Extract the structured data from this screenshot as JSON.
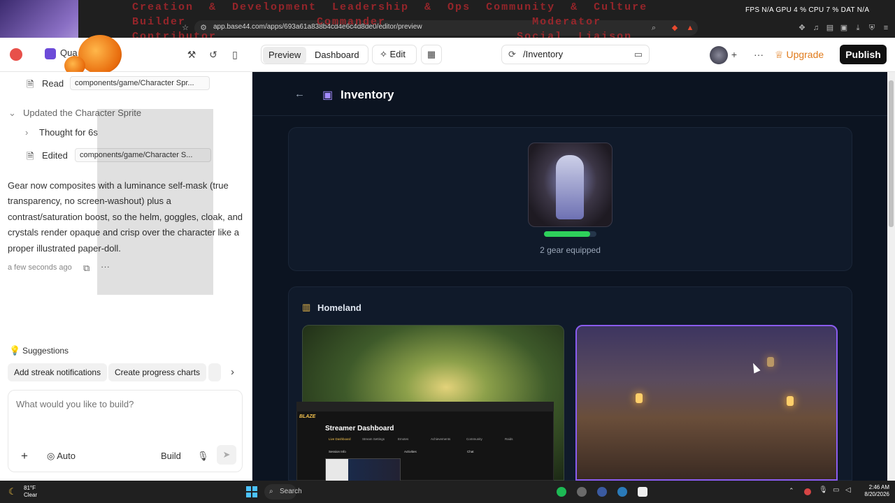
{
  "browser": {
    "url": "app.base44.com/apps/693a61a838b4cd4e6c4d8de0/editor/preview",
    "overlay_text": "Creation  &  Development  Leadership  &  Ops  Community  &  Culture\nBuilder                 Commander                   Moderator\nContributor                                       Social  Liaison\nCollaborator",
    "stats": "FPS N/A   GPU 4 %   CPU 7 %   DAT N/A"
  },
  "topbar": {
    "project_label": "Qua",
    "tab_preview": "Preview",
    "tab_dashboard": "Dashboard",
    "edit_label": "Edit",
    "route": "/Inventory",
    "upgrade_label": "Upgrade",
    "publish_label": "Publish"
  },
  "chat": {
    "read_label": "Read",
    "read_file": "components/game/Character Spr...",
    "updated_label": "Updated the Character Sprite",
    "thought_label": "Thought for 6s",
    "edited_label": "Edited",
    "edited_file": "components/game/Character S...",
    "message": "Gear now composites with a luminance self-mask (true transparency, no screen-washout) plus a contrast/saturation boost, so the helm, goggles, cloak, and crystals render opaque and crisp over the character like a proper illustrated paper-doll.",
    "timestamp": "a few seconds ago",
    "suggestions_label": "Suggestions",
    "suggestions": [
      "Add streak notifications",
      "Create progress charts"
    ],
    "prompt_placeholder": "What would you like to build?",
    "mode_label": "Auto",
    "build_label": "Build"
  },
  "inventory": {
    "title": "Inventory",
    "health_fraction": 0.88,
    "gear_text": "2 gear equipped",
    "homeland_label": "Homeland"
  },
  "popup": {
    "logo": "BLAZE",
    "title": "Streamer Dashboard",
    "nav": [
      "Live Dashboard",
      "Stream Settings",
      "Emotes",
      "Achievements",
      "Community",
      "Raids"
    ],
    "session": "Session Info",
    "activities": "Activities",
    "chat": "Chat"
  },
  "taskbar": {
    "weather_temp": "81°F",
    "weather_desc": "Clear",
    "search_label": "Search",
    "time": "2:46 AM",
    "date": "8/20/2026"
  },
  "colors": {
    "accent_upgrade": "#e07a1a",
    "health": "#2ed15b",
    "selected_border": "#8a5cf0",
    "preview_bg": "#0c1421"
  }
}
